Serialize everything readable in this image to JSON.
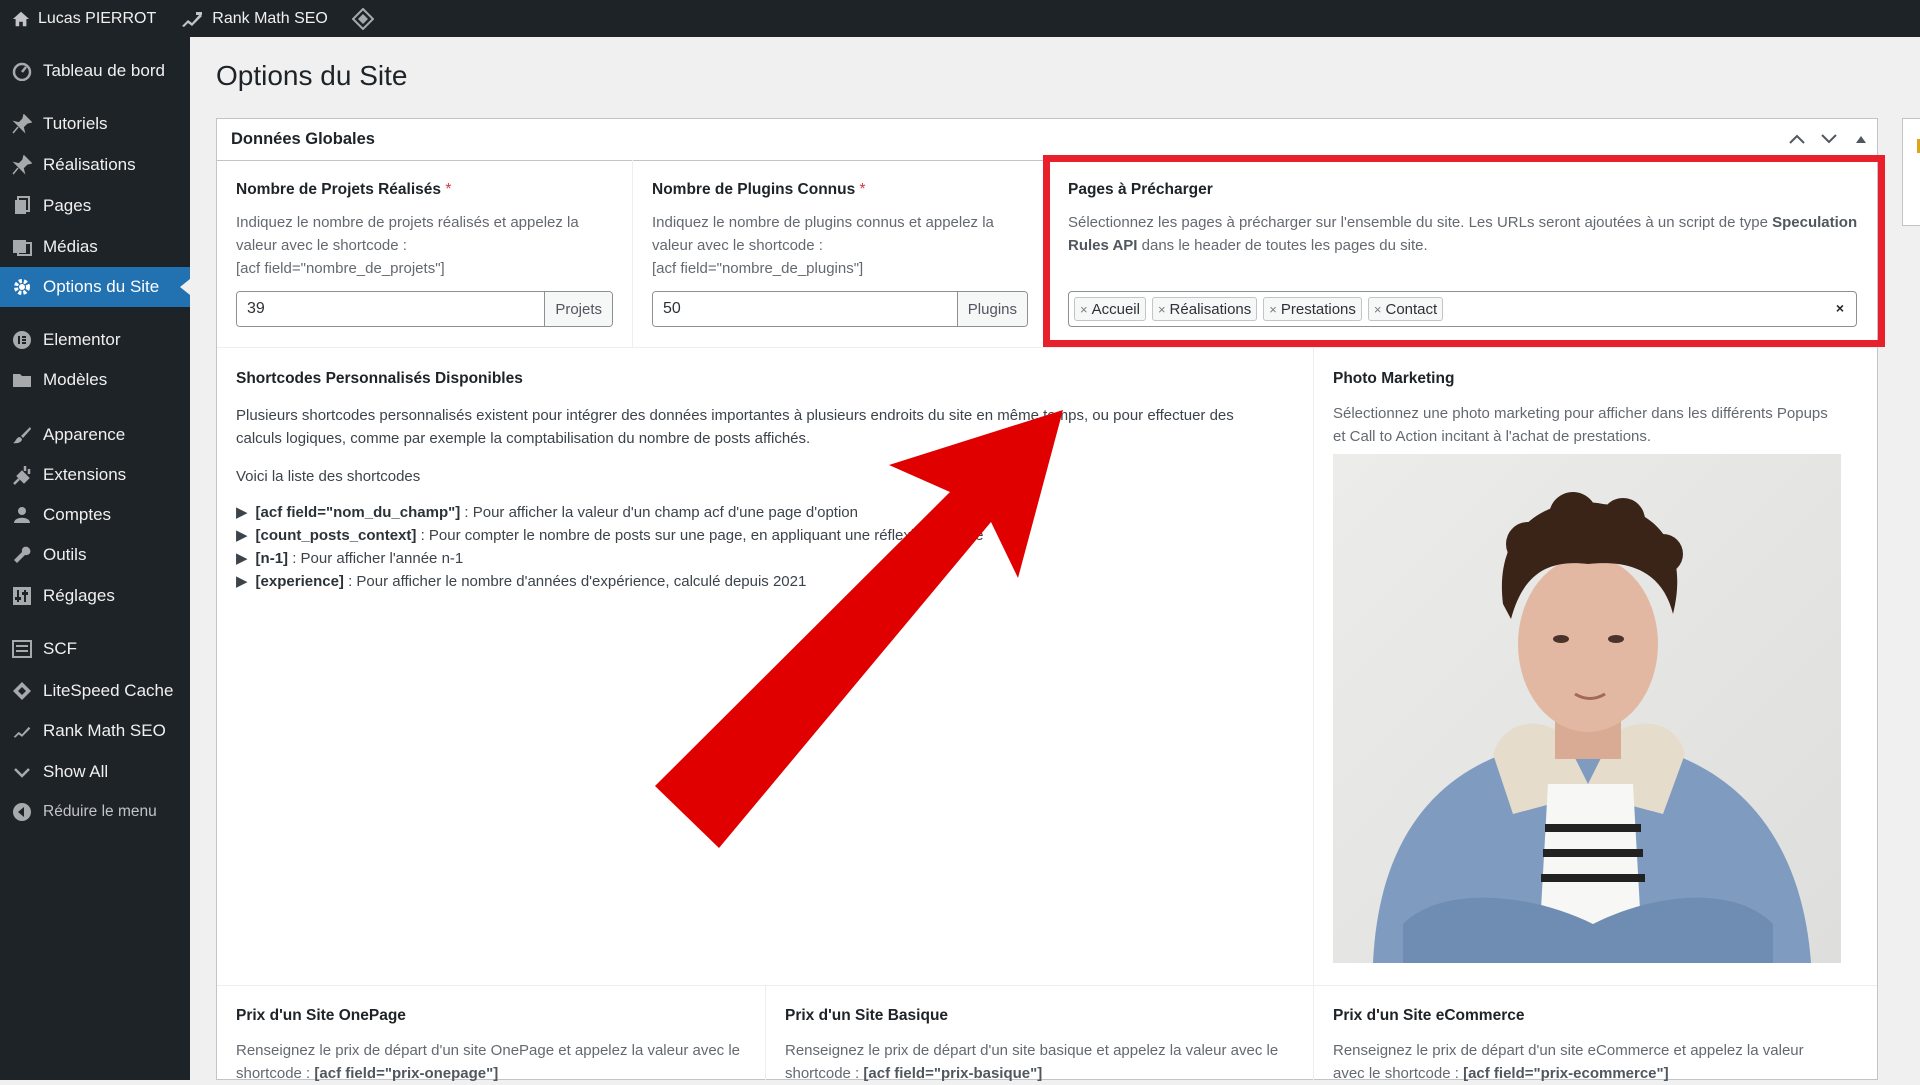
{
  "adminbar": {
    "site_name": "Lucas PIERROT",
    "rankmath_label": "Rank Math SEO",
    "icons": [
      "home-icon",
      "rankmath-icon",
      "diamond-icon"
    ]
  },
  "sidebar": {
    "items": [
      {
        "label": "Tableau de bord",
        "icon": "dashboard-icon"
      },
      {
        "label": "Tutoriels",
        "icon": "pin-icon"
      },
      {
        "label": "Réalisations",
        "icon": "pin-icon"
      },
      {
        "label": "Pages",
        "icon": "pages-icon"
      },
      {
        "label": "Médias",
        "icon": "media-icon"
      },
      {
        "label": "Options du Site",
        "icon": "gear-icon",
        "active": true
      },
      {
        "label": "Elementor",
        "icon": "elementor-icon"
      },
      {
        "label": "Modèles",
        "icon": "folder-icon"
      },
      {
        "label": "Apparence",
        "icon": "brush-icon"
      },
      {
        "label": "Extensions",
        "icon": "plugin-icon"
      },
      {
        "label": "Comptes",
        "icon": "user-icon"
      },
      {
        "label": "Outils",
        "icon": "wrench-icon"
      },
      {
        "label": "Réglages",
        "icon": "settings-icon"
      },
      {
        "label": "SCF",
        "icon": "scf-icon"
      },
      {
        "label": "LiteSpeed Cache",
        "icon": "diamond-icon"
      },
      {
        "label": "Rank Math SEO",
        "icon": "rankmath-icon"
      },
      {
        "label": "Show All",
        "icon": "chevron-down-icon"
      },
      {
        "label": "Réduire le menu",
        "icon": "collapse-icon"
      }
    ]
  },
  "page": {
    "title": "Options du Site"
  },
  "card": {
    "title": "Données Globales",
    "fields": {
      "projects": {
        "label": "Nombre de Projets Réalisés",
        "required": "*",
        "desc1": "Indiquez le nombre de projets réalisés et appelez la",
        "desc2": "valeur avec le shortcode :",
        "desc3": "[acf field=\"nombre_de_projets\"]",
        "value": "39",
        "append": "Projets"
      },
      "plugins": {
        "label": "Nombre de Plugins Connus",
        "required": "*",
        "desc1": "Indiquez le nombre de plugins connus et appelez la",
        "desc2": "valeur avec le shortcode :",
        "desc3": "[acf field=\"nombre_de_plugins\"]",
        "value": "50",
        "append": "Plugins"
      },
      "preload": {
        "label": "Pages à Précharger",
        "desc_a": "Sélectionnez les pages à précharger sur l'ensemble du site. Les URLs seront ajoutées à un script de type ",
        "desc_b": "Speculation",
        "desc_c": "Rules API",
        "desc_d": " dans le header de toutes les pages du site.",
        "chips": [
          "Accueil",
          "Réalisations",
          "Prestations",
          "Contact"
        ],
        "clear": "×"
      },
      "shortcodes": {
        "label": "Shortcodes Personnalisés Disponibles",
        "p1": "Plusieurs shortcodes personnalisés existent pour intégrer des données importantes à plusieurs endroits du site en même temps, ou pour effectuer des",
        "p2": "calculs logiques, comme par exemple la comptabilisation du nombre de posts affichés.",
        "p3": "Voici la liste des shortcodes",
        "list": [
          {
            "code": "[acf field=\"nom_du_champ\"]",
            "text": " : Pour afficher la valeur d'un champ acf d'une page d'option"
          },
          {
            "code": "[count_posts_context]",
            "text": " : Pour compter le nombre de posts sur une page, en appliquant une réflexion logique"
          },
          {
            "code": "[n-1]",
            "text": " : Pour afficher l'année n-1"
          },
          {
            "code": "[experience]",
            "text": " : Pour afficher le nombre d'années d'expérience, calculé depuis 2021"
          }
        ]
      },
      "photo": {
        "label": "Photo Marketing",
        "desc1": "Sélectionnez une photo marketing pour afficher dans les différents Popups",
        "desc2": "et Call to Action incitant à l'achat de prestations."
      },
      "onepage": {
        "label": "Prix d'un Site OnePage",
        "desc1": "Renseignez le prix de départ d'un site OnePage et appelez la valeur avec le",
        "desc2a": "shortcode : ",
        "desc2b": "[acf field=\"prix-onepage\"]"
      },
      "basique": {
        "label": "Prix d'un Site Basique",
        "desc1": "Renseignez le prix de départ d'un site basique et appelez la valeur avec le",
        "desc2a": "shortcode : ",
        "desc2b": "[acf field=\"prix-basique\"]"
      },
      "ecommerce": {
        "label": "Prix d'un Site eCommerce",
        "desc1": "Renseignez le prix de départ d'un site eCommerce et appelez la valeur",
        "desc2a": "avec le shortcode : ",
        "desc2b": "[acf field=\"prix-ecommerce\"]"
      }
    }
  },
  "colors": {
    "admin_dark": "#1d2327",
    "active_blue": "#2271b1",
    "highlight_red": "#e8202b",
    "arrow_red": "#e00000"
  }
}
